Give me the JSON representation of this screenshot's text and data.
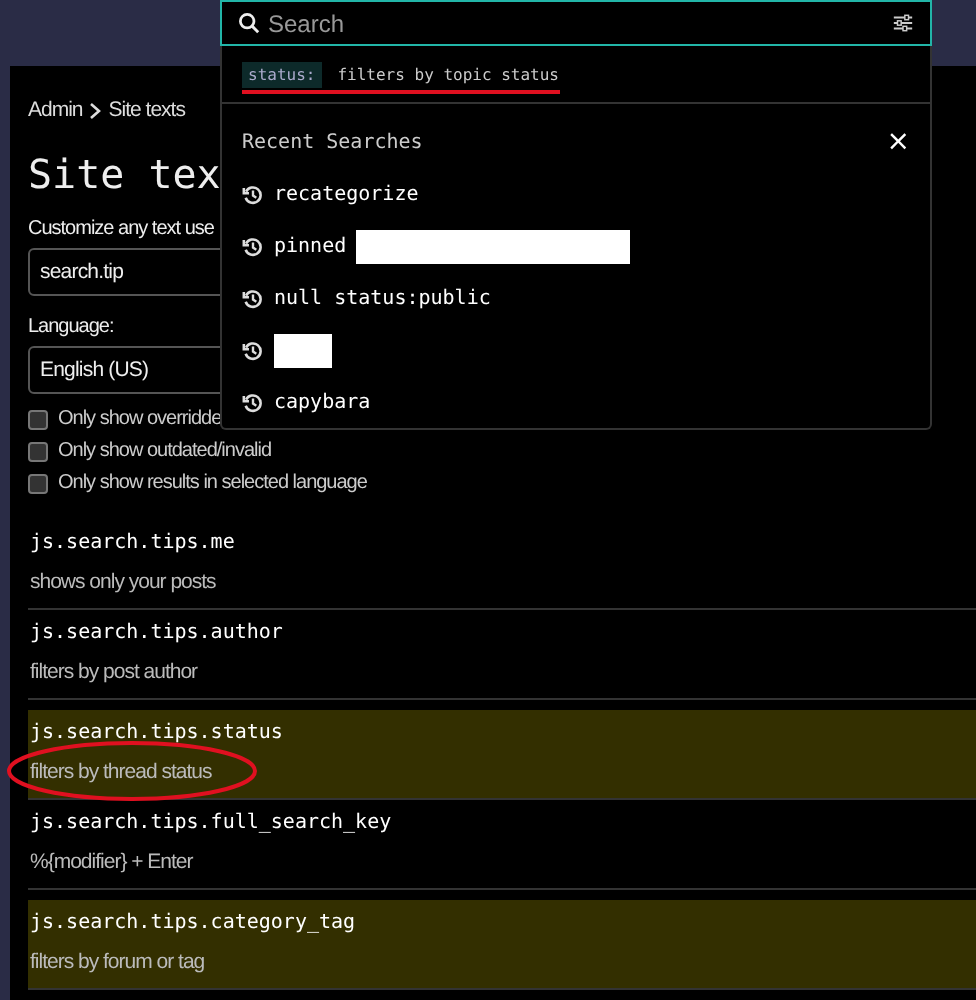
{
  "breadcrumb": {
    "items": [
      "Admin",
      "Site texts"
    ]
  },
  "title": "Site tex",
  "filter_label": "Customize any text use",
  "filter_field": {
    "value": "search.tip"
  },
  "language_label": "Language:",
  "language_select": {
    "value": "English (US)"
  },
  "options": [
    {
      "label": "Only show overridde",
      "checked": false
    },
    {
      "label": "Only show outdated/invalid",
      "checked": false
    },
    {
      "label": "Only show results in selected language",
      "checked": false
    }
  ],
  "rows": [
    {
      "key": "js.search.tips.me",
      "text": "shows only your posts",
      "highlighted": false,
      "circled": false
    },
    {
      "key": "js.search.tips.author",
      "text": "filters by post author",
      "highlighted": false,
      "circled": false
    },
    {
      "key": "js.search.tips.status",
      "text": "filters by thread status",
      "highlighted": true,
      "circled": true
    },
    {
      "key": "js.search.tips.full_search_key",
      "text": "%{modifier} + Enter",
      "highlighted": false,
      "circled": false
    },
    {
      "key": "js.search.tips.category_tag",
      "text": "filters by forum or tag",
      "highlighted": true,
      "circled": false
    }
  ],
  "search": {
    "placeholder": "Search",
    "tip": {
      "key": "status:",
      "text": "filters by topic status",
      "underlined": true
    },
    "recent_title": "Recent Searches",
    "close": "×",
    "recent": [
      {
        "text": "recategorize",
        "redacted": false
      },
      {
        "text": "pinned",
        "redacted": true
      },
      {
        "text": "null status:public",
        "redacted": false
      },
      {
        "redacted": true
      },
      {
        "text": "capybara",
        "redacted": false
      }
    ]
  }
}
